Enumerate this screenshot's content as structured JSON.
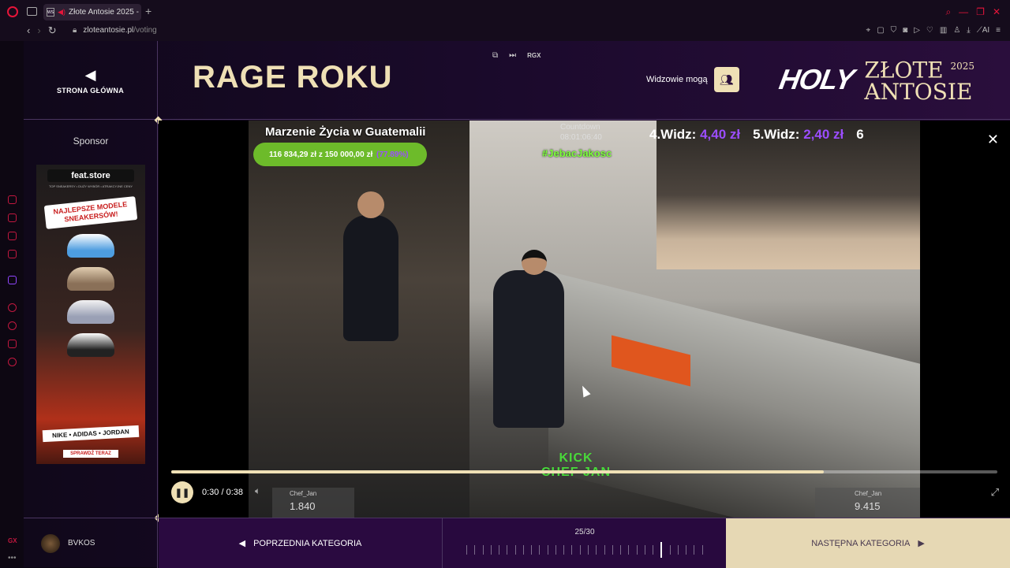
{
  "browser": {
    "tab_title": "Złote Antosie 2025 - N",
    "favicon_text": "WS",
    "url_host": "zloteantosie.pl",
    "url_path": "/voting",
    "addr_ai_label": "AI"
  },
  "header": {
    "home_label": "STRONA GŁÓWNA",
    "category_title": "RAGE ROKU",
    "rgx_label": "RGX",
    "viewers_label": "Widzowie mogą",
    "brand_holy": "HOLY",
    "brand_name_line1": "ZŁOTE",
    "brand_name_line2": "ANTOSIE",
    "brand_year": "2025"
  },
  "sidebar": {
    "sponsor_label": "Sponsor",
    "ad": {
      "store": "feat.store",
      "tagline": "TOP SNEAKERSY • DUŻY WYBÓR • ATRAKCYJNE CENY",
      "headline": "NAJLEPSZE MODELE SNEAKERSÓW!",
      "brands": "NIKE • ADIDAS • JORDAN",
      "cta": "SPRAWDŹ TERAZ"
    }
  },
  "video": {
    "stream_title": "Marzenie Życia w Guatemalii",
    "goal_text": "116 834,29 zł z 150 000,00 zł",
    "goal_pct": "(77.89%)",
    "countdown_label": "Countdown",
    "countdown_value": "08:01:06:40",
    "hashtag": "#JebacJakosc",
    "ticker": [
      {
        "label": "4.Widz:",
        "value": "4,40 zł"
      },
      {
        "label": "5.Widz:",
        "value": "2,40 zł"
      },
      {
        "label": "6",
        "value": ""
      }
    ],
    "overlay_line1": "KICK",
    "overlay_line2": "CHEF JAN",
    "chat_left_name": "Chef_Jan",
    "chat_left_count": "1.840",
    "chat_right_name": "Chef_Jan",
    "chat_right_count": "9.415",
    "time": "0:30 / 0:38",
    "progress": 0.79
  },
  "footer": {
    "username": "BVKOS",
    "prev_label": "POPRZEDNIA KATEGORIA",
    "counter": "25/30",
    "current": 25,
    "total": 30,
    "next_label": "NASTĘPNA KATEGORIA"
  },
  "colors": {
    "accent_gold": "#efe0b5",
    "opera_red": "#e5153a",
    "purple": "#9b4dff",
    "green": "#7cff3a"
  }
}
